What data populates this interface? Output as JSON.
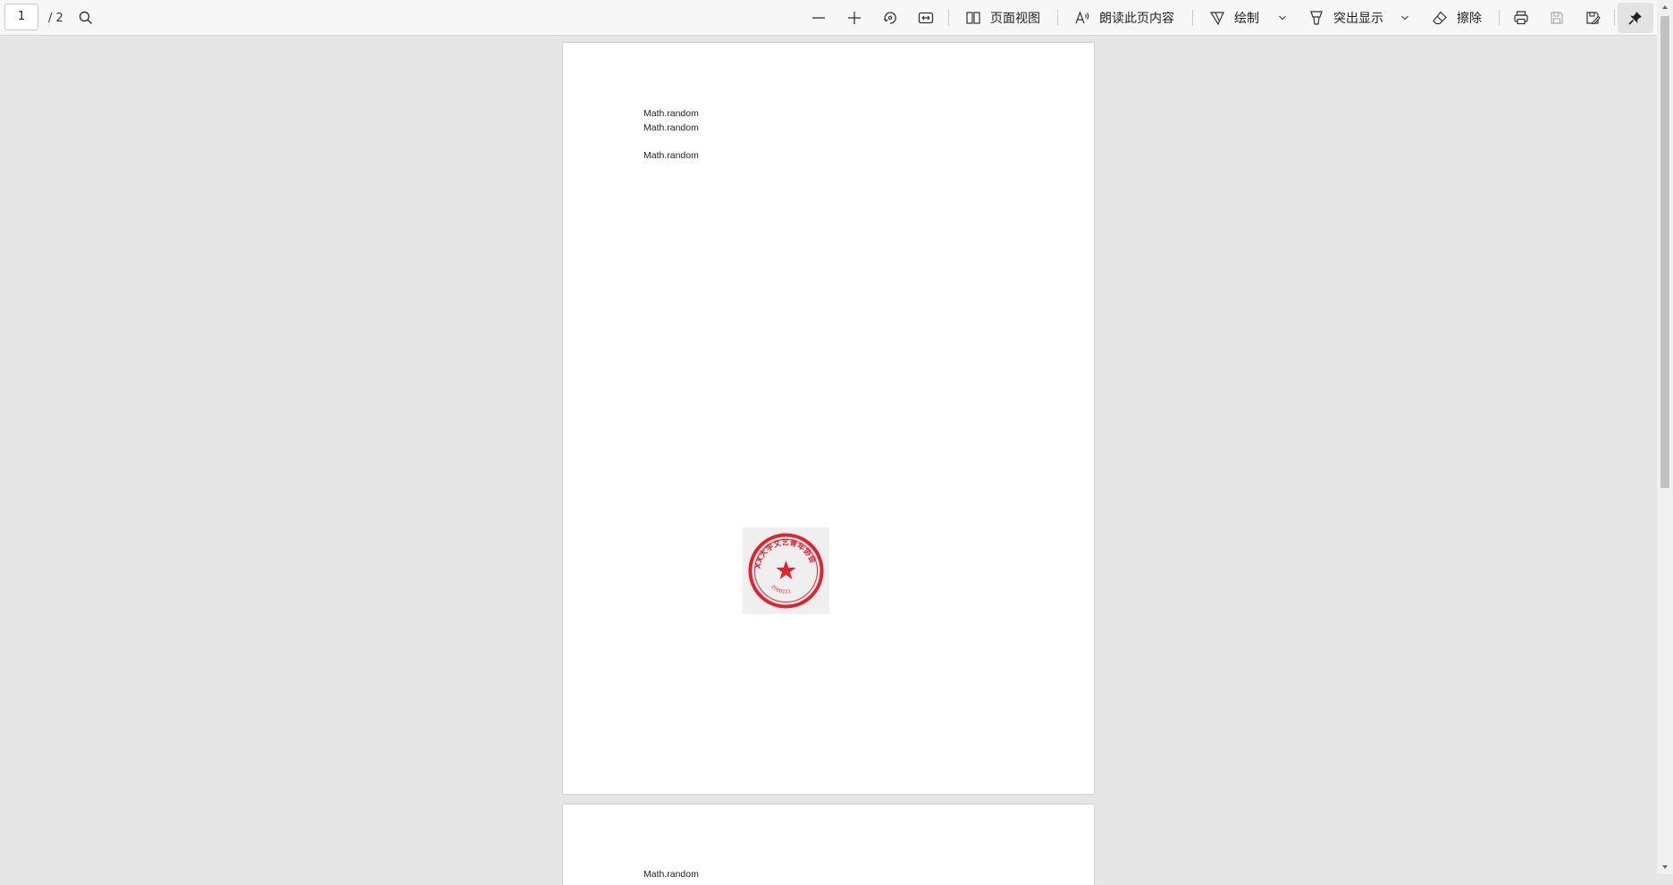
{
  "toolbar": {
    "page_current": "1",
    "page_total": "/ 2",
    "page_view_label": "页面视图",
    "read_aloud_label": "朗读此页内容",
    "draw_label": "绘制",
    "highlight_label": "突出显示",
    "erase_label": "擦除",
    "icons": [
      "search-icon",
      "zoom-out-icon",
      "zoom-in-icon",
      "rotate-icon",
      "fit-width-icon",
      "page-view-icon",
      "read-aloud-icon",
      "draw-icon",
      "highlight-icon",
      "eraser-icon",
      "print-icon",
      "save-icon",
      "save-as-icon",
      "pin-icon"
    ]
  },
  "document": {
    "page1": {
      "lines": [
        "Math.random",
        "Math.random",
        "Math.random"
      ],
      "stamp": {
        "text_ring": "XX大学文艺青年协会",
        "number": "2500111",
        "color": "#e0242f"
      }
    },
    "page2": {
      "lines": [
        "Math.random"
      ]
    }
  },
  "colors": {
    "background": "#e6e6e6",
    "toolbar": "#f7f7f7",
    "stamp_red": "#e0242f"
  }
}
